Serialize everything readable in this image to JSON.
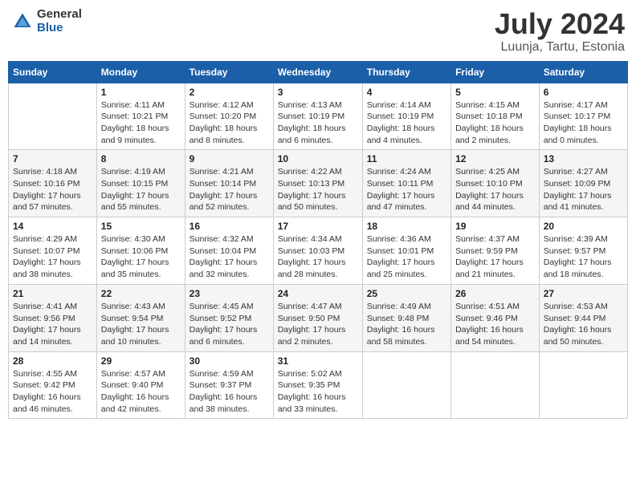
{
  "header": {
    "logo_general": "General",
    "logo_blue": "Blue",
    "month": "July 2024",
    "location": "Luunja, Tartu, Estonia"
  },
  "weekdays": [
    "Sunday",
    "Monday",
    "Tuesday",
    "Wednesday",
    "Thursday",
    "Friday",
    "Saturday"
  ],
  "weeks": [
    [
      {
        "day": "",
        "sunrise": "",
        "sunset": "",
        "daylight": ""
      },
      {
        "day": "1",
        "sunrise": "Sunrise: 4:11 AM",
        "sunset": "Sunset: 10:21 PM",
        "daylight": "Daylight: 18 hours and 9 minutes."
      },
      {
        "day": "2",
        "sunrise": "Sunrise: 4:12 AM",
        "sunset": "Sunset: 10:20 PM",
        "daylight": "Daylight: 18 hours and 8 minutes."
      },
      {
        "day": "3",
        "sunrise": "Sunrise: 4:13 AM",
        "sunset": "Sunset: 10:19 PM",
        "daylight": "Daylight: 18 hours and 6 minutes."
      },
      {
        "day": "4",
        "sunrise": "Sunrise: 4:14 AM",
        "sunset": "Sunset: 10:19 PM",
        "daylight": "Daylight: 18 hours and 4 minutes."
      },
      {
        "day": "5",
        "sunrise": "Sunrise: 4:15 AM",
        "sunset": "Sunset: 10:18 PM",
        "daylight": "Daylight: 18 hours and 2 minutes."
      },
      {
        "day": "6",
        "sunrise": "Sunrise: 4:17 AM",
        "sunset": "Sunset: 10:17 PM",
        "daylight": "Daylight: 18 hours and 0 minutes."
      }
    ],
    [
      {
        "day": "7",
        "sunrise": "Sunrise: 4:18 AM",
        "sunset": "Sunset: 10:16 PM",
        "daylight": "Daylight: 17 hours and 57 minutes."
      },
      {
        "day": "8",
        "sunrise": "Sunrise: 4:19 AM",
        "sunset": "Sunset: 10:15 PM",
        "daylight": "Daylight: 17 hours and 55 minutes."
      },
      {
        "day": "9",
        "sunrise": "Sunrise: 4:21 AM",
        "sunset": "Sunset: 10:14 PM",
        "daylight": "Daylight: 17 hours and 52 minutes."
      },
      {
        "day": "10",
        "sunrise": "Sunrise: 4:22 AM",
        "sunset": "Sunset: 10:13 PM",
        "daylight": "Daylight: 17 hours and 50 minutes."
      },
      {
        "day": "11",
        "sunrise": "Sunrise: 4:24 AM",
        "sunset": "Sunset: 10:11 PM",
        "daylight": "Daylight: 17 hours and 47 minutes."
      },
      {
        "day": "12",
        "sunrise": "Sunrise: 4:25 AM",
        "sunset": "Sunset: 10:10 PM",
        "daylight": "Daylight: 17 hours and 44 minutes."
      },
      {
        "day": "13",
        "sunrise": "Sunrise: 4:27 AM",
        "sunset": "Sunset: 10:09 PM",
        "daylight": "Daylight: 17 hours and 41 minutes."
      }
    ],
    [
      {
        "day": "14",
        "sunrise": "Sunrise: 4:29 AM",
        "sunset": "Sunset: 10:07 PM",
        "daylight": "Daylight: 17 hours and 38 minutes."
      },
      {
        "day": "15",
        "sunrise": "Sunrise: 4:30 AM",
        "sunset": "Sunset: 10:06 PM",
        "daylight": "Daylight: 17 hours and 35 minutes."
      },
      {
        "day": "16",
        "sunrise": "Sunrise: 4:32 AM",
        "sunset": "Sunset: 10:04 PM",
        "daylight": "Daylight: 17 hours and 32 minutes."
      },
      {
        "day": "17",
        "sunrise": "Sunrise: 4:34 AM",
        "sunset": "Sunset: 10:03 PM",
        "daylight": "Daylight: 17 hours and 28 minutes."
      },
      {
        "day": "18",
        "sunrise": "Sunrise: 4:36 AM",
        "sunset": "Sunset: 10:01 PM",
        "daylight": "Daylight: 17 hours and 25 minutes."
      },
      {
        "day": "19",
        "sunrise": "Sunrise: 4:37 AM",
        "sunset": "Sunset: 9:59 PM",
        "daylight": "Daylight: 17 hours and 21 minutes."
      },
      {
        "day": "20",
        "sunrise": "Sunrise: 4:39 AM",
        "sunset": "Sunset: 9:57 PM",
        "daylight": "Daylight: 17 hours and 18 minutes."
      }
    ],
    [
      {
        "day": "21",
        "sunrise": "Sunrise: 4:41 AM",
        "sunset": "Sunset: 9:56 PM",
        "daylight": "Daylight: 17 hours and 14 minutes."
      },
      {
        "day": "22",
        "sunrise": "Sunrise: 4:43 AM",
        "sunset": "Sunset: 9:54 PM",
        "daylight": "Daylight: 17 hours and 10 minutes."
      },
      {
        "day": "23",
        "sunrise": "Sunrise: 4:45 AM",
        "sunset": "Sunset: 9:52 PM",
        "daylight": "Daylight: 17 hours and 6 minutes."
      },
      {
        "day": "24",
        "sunrise": "Sunrise: 4:47 AM",
        "sunset": "Sunset: 9:50 PM",
        "daylight": "Daylight: 17 hours and 2 minutes."
      },
      {
        "day": "25",
        "sunrise": "Sunrise: 4:49 AM",
        "sunset": "Sunset: 9:48 PM",
        "daylight": "Daylight: 16 hours and 58 minutes."
      },
      {
        "day": "26",
        "sunrise": "Sunrise: 4:51 AM",
        "sunset": "Sunset: 9:46 PM",
        "daylight": "Daylight: 16 hours and 54 minutes."
      },
      {
        "day": "27",
        "sunrise": "Sunrise: 4:53 AM",
        "sunset": "Sunset: 9:44 PM",
        "daylight": "Daylight: 16 hours and 50 minutes."
      }
    ],
    [
      {
        "day": "28",
        "sunrise": "Sunrise: 4:55 AM",
        "sunset": "Sunset: 9:42 PM",
        "daylight": "Daylight: 16 hours and 46 minutes."
      },
      {
        "day": "29",
        "sunrise": "Sunrise: 4:57 AM",
        "sunset": "Sunset: 9:40 PM",
        "daylight": "Daylight: 16 hours and 42 minutes."
      },
      {
        "day": "30",
        "sunrise": "Sunrise: 4:59 AM",
        "sunset": "Sunset: 9:37 PM",
        "daylight": "Daylight: 16 hours and 38 minutes."
      },
      {
        "day": "31",
        "sunrise": "Sunrise: 5:02 AM",
        "sunset": "Sunset: 9:35 PM",
        "daylight": "Daylight: 16 hours and 33 minutes."
      },
      {
        "day": "",
        "sunrise": "",
        "sunset": "",
        "daylight": ""
      },
      {
        "day": "",
        "sunrise": "",
        "sunset": "",
        "daylight": ""
      },
      {
        "day": "",
        "sunrise": "",
        "sunset": "",
        "daylight": ""
      }
    ]
  ]
}
